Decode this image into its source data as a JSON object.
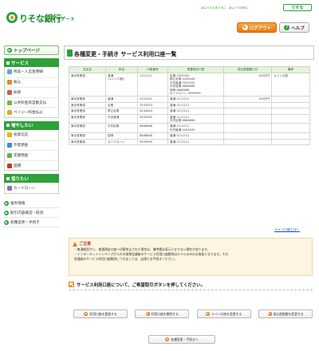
{
  "header": {
    "brand": "りそな銀行",
    "product": "マイゲート",
    "slogan": "誰よりもお客さまに、誰よりも地域に",
    "brand_badge": "りそな",
    "logout_label": "ログアウト",
    "help_label": "ヘルプ"
  },
  "sidebar": {
    "top_label": "トップページ",
    "sections": [
      {
        "title": "サービス",
        "items": [
          "残高・入出金明細",
          "振込",
          "振替",
          "公共料金等自動支払",
          "ペイジー料金払込"
        ]
      },
      {
        "title": "増やしたい",
        "items": [
          "投資信託",
          "外貨預金",
          "定期預金",
          "国債"
        ]
      },
      {
        "title": "借りたい",
        "items": [
          "カードローン"
        ]
      }
    ],
    "links": [
      "金利情報",
      "取引内容確認・取消",
      "各種変更・手続き"
    ]
  },
  "main": {
    "title": "各種変更・手続き サービス利用口座一覧",
    "columns": [
      "支店名",
      "科目",
      "口座番号",
      "振替相手口座",
      "振込限度額/1日",
      "備考"
    ],
    "rows": [
      {
        "branch": "東京営業部",
        "type": "普通\n(メイン口座)",
        "account": "1111111",
        "partner": "定期 3333333\n積立定期 4444444\n外貨普通 5555555\n外貨定期 6666666\n国債 8888888\nカードローン 9999999",
        "limit": "100万円",
        "note": "メイン口座"
      },
      {
        "branch": "東京営業部",
        "type": "普通",
        "account": "2222222",
        "partner": "普通 1111111",
        "limit": "100万円",
        "note": ""
      },
      {
        "branch": "東京営業部",
        "type": "定期",
        "account": "3333333",
        "partner": "普通 1111111",
        "limit": "",
        "note": ""
      },
      {
        "branch": "東京営業部",
        "type": "積立定期",
        "account": "4444444",
        "partner": "普通 1111111",
        "limit": "",
        "note": ""
      },
      {
        "branch": "東京営業部",
        "type": "外貨普通",
        "account": "5555555",
        "partner": "普通 1111111\n外貨定期 6666666",
        "limit": "",
        "note": ""
      },
      {
        "branch": "東京営業部",
        "type": "外貨定期",
        "account": "6666666",
        "partner": "普通 1111111\n外貨普通 5555555",
        "limit": "",
        "note": ""
      },
      {
        "branch": "東京営業部",
        "type": "国債",
        "account": "8888888",
        "partner": "普通 1111111",
        "limit": "",
        "note": ""
      },
      {
        "branch": "東京営業部",
        "type": "カードローン",
        "account": "9999999",
        "partner": "普通 1111111",
        "limit": "",
        "note": ""
      }
    ],
    "main_account_link": "メイン口座とは？"
  },
  "notice": {
    "heading": "ご注意",
    "lines": [
      "・無通帳型から、普通預金口座へ切替申込された場合は、備考欄は表示となりない場合があります。",
      "・インターネットバンキングからの外貨預金講座のサービス利用口座解除はホドルのみのお取扱となります。その",
      "  他通貨のサービス利用口座解除につきましては、店頭でお手続きください。"
    ]
  },
  "instruction": "サービス利用口座について、ご希望取引ボタンを押してください。",
  "actions": [
    "利用口座を登録する",
    "利用口座を解除する",
    "メイン口座を変更する",
    "振込限度額を変更する"
  ],
  "back_label": "各種変更・手続きへ"
}
